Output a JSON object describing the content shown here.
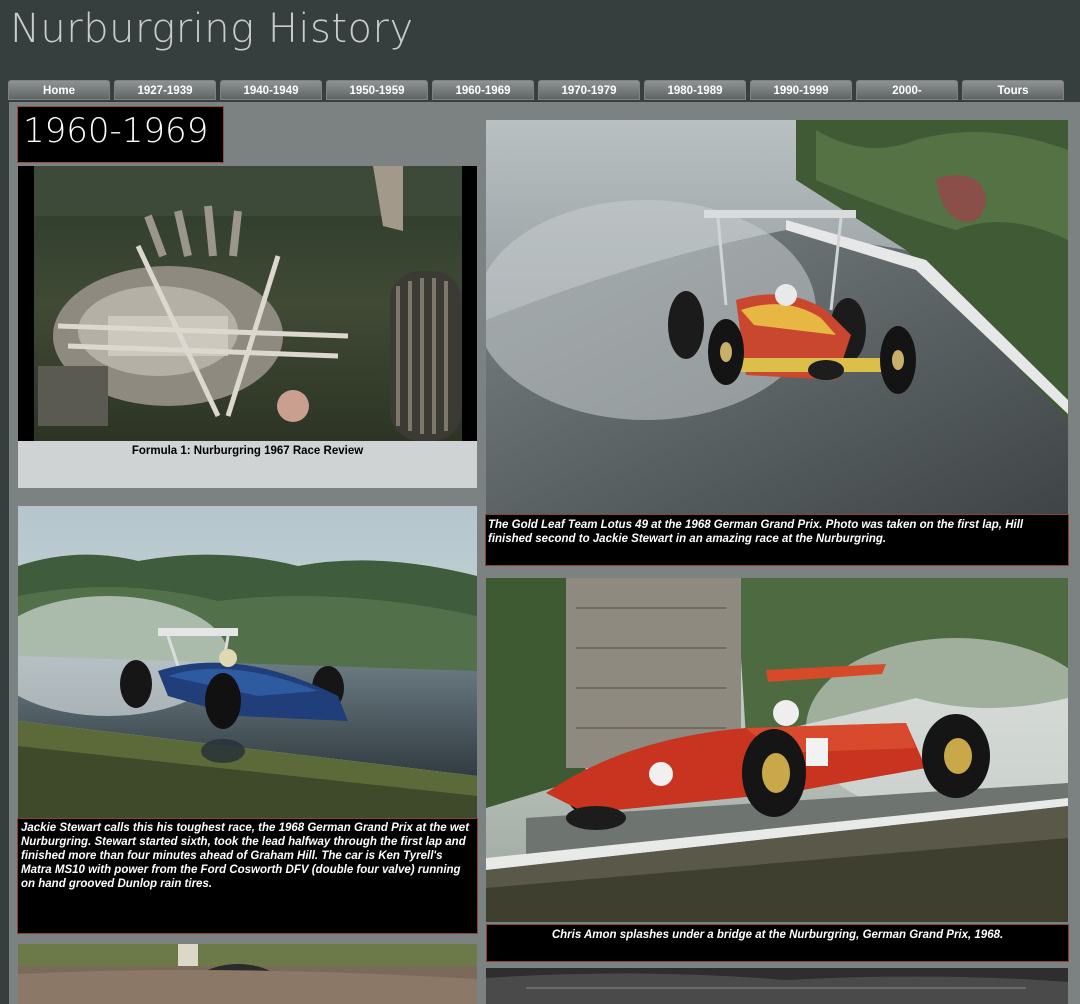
{
  "site": {
    "title": "Nurburgring History"
  },
  "nav": {
    "tabs": [
      {
        "label": "Home"
      },
      {
        "label": "1927-1939"
      },
      {
        "label": "1940-1949"
      },
      {
        "label": "1950-1959"
      },
      {
        "label": "1960-1969"
      },
      {
        "label": "1970-1979"
      },
      {
        "label": "1980-1989"
      },
      {
        "label": "1990-1999"
      },
      {
        "label": "2000-"
      },
      {
        "label": "Tours"
      }
    ],
    "active_index": 4
  },
  "page": {
    "heading": "1960-1969"
  },
  "video": {
    "caption": "Formula 1: Nurburgring 1967 Race Review"
  },
  "photos": {
    "lotus": {
      "caption": "The Gold Leaf Team Lotus 49 at the 1968 German Grand Prix. Photo was taken on the first lap, Hill finished second to Jackie Stewart in an amazing race at the Nurburgring."
    },
    "stewart": {
      "caption": "Jackie Stewart calls this his toughest race, the 1968 German Grand Prix at the wet Nurburgring. Stewart started sixth, took the lead halfway through the first lap and finished more than four minutes ahead of Graham Hill.   The car is Ken Tyrell's Matra MS10 with power from the Ford Cosworth DFV (double four valve) running on hand grooved Dunlop rain tires."
    },
    "amon": {
      "caption": "Chris Amon splashes under a bridge at the Nurburgring, German Grand Prix, 1968."
    }
  },
  "colors": {
    "background": "#373e3e",
    "content": "#7c8181",
    "caption_border": "#8e4036",
    "tab_text": "#ffffff"
  }
}
